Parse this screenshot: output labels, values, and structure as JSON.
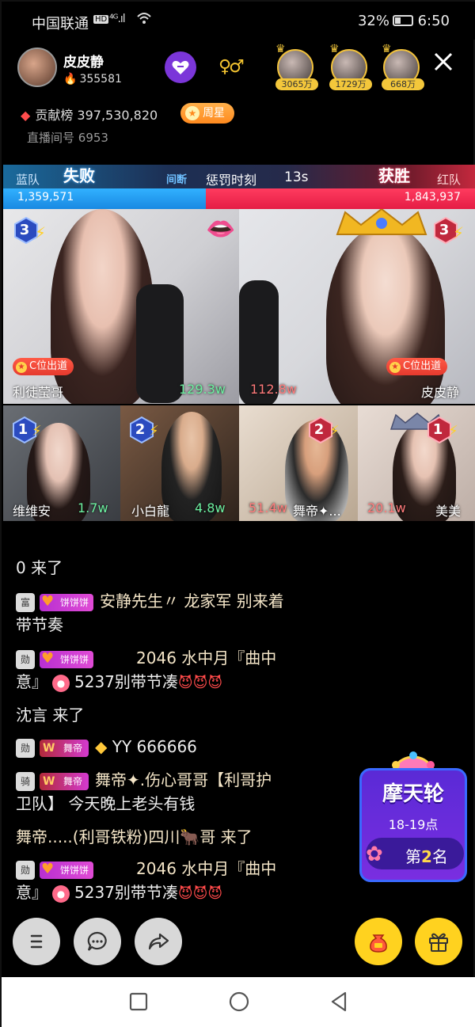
{
  "status_bar": {
    "carrier": "中国联通",
    "hd": "HD",
    "signal": "⁴ᴳ.ıl",
    "battery_pct": "32%",
    "time": "6:50"
  },
  "host": {
    "name": "皮皮静",
    "fans": "355581"
  },
  "viewers": [
    {
      "count": "3065万"
    },
    {
      "count": "1729万"
    },
    {
      "count": "668万"
    }
  ],
  "contribution": {
    "label": "贡献榜",
    "value": "397,530,820",
    "week_star": "周星"
  },
  "room": {
    "label": "直播间号",
    "id": "6953"
  },
  "pk": {
    "blue_label": "蓝队",
    "red_label": "红队",
    "blue_result": "失败",
    "red_result": "获胜",
    "punish_icon": "间断",
    "punish_text": "惩罚时刻",
    "seconds": "13s",
    "blue_score": "1,359,571",
    "red_score": "1,843,937",
    "colors": {
      "blue": "#1989e2",
      "red": "#e51d45"
    }
  },
  "main_tiles": [
    {
      "name": "利徒莹哥",
      "score": "129.3w",
      "level": "3",
      "c_position": "C位出道"
    },
    {
      "name": "皮皮静",
      "score": "112.8w",
      "level": "3",
      "c_position": "C位出道"
    }
  ],
  "small_tiles": [
    {
      "name": "维维安",
      "score": "1.7w",
      "level": "1"
    },
    {
      "name": "小白龍",
      "score": "4.8w",
      "level": "2"
    },
    {
      "name": "舞帝✦...",
      "score": "51.4w",
      "level": "2"
    },
    {
      "name": "美美",
      "score": "20.1w",
      "level": "1"
    }
  ],
  "chat": {
    "l1": "0 来了",
    "l2_badge_level": "富",
    "l2_badge_fan": "饼饼饼",
    "l2_user": "安静先生〃 龙家军 别来着",
    "l2_cont": "带节奏",
    "l3_badge_level": "勋",
    "l3_badge_fan": "饼饼饼",
    "l3_text": "2046 水中月『曲中",
    "l3_cont": "意』",
    "l3_tail": "5237别带节凑",
    "l4": "沈言 来了",
    "l5_badge_level": "勋",
    "l5_badge_fan": "舞帝",
    "l5_text": "YY 666666",
    "l6_badge_level": "骑",
    "l6_badge_fan": "舞帝",
    "l6_text": "舞帝✦.伤心哥哥【利哥护",
    "l6_cont": "卫队】 今天晚上老头有钱",
    "l7": "舞帝.....(利哥铁粉)四川🐂哥 来了",
    "l8_badge_level": "勋",
    "l8_badge_fan": "饼饼饼",
    "l8_text": "2046 水中月『曲中",
    "l8_cont": "意』",
    "l8_tail": "5237别带节凑"
  },
  "promo": {
    "title": "摩天轮",
    "time": "18-19点",
    "rank_prefix": "第",
    "rank_num": "2",
    "rank_suffix": "名"
  },
  "icons": [
    "menu-icon",
    "chat-icon",
    "share-icon",
    "lucky-bag-icon",
    "gift-icon",
    "back-icon",
    "home-icon",
    "recents-icon",
    "close-icon",
    "heart-icon"
  ]
}
